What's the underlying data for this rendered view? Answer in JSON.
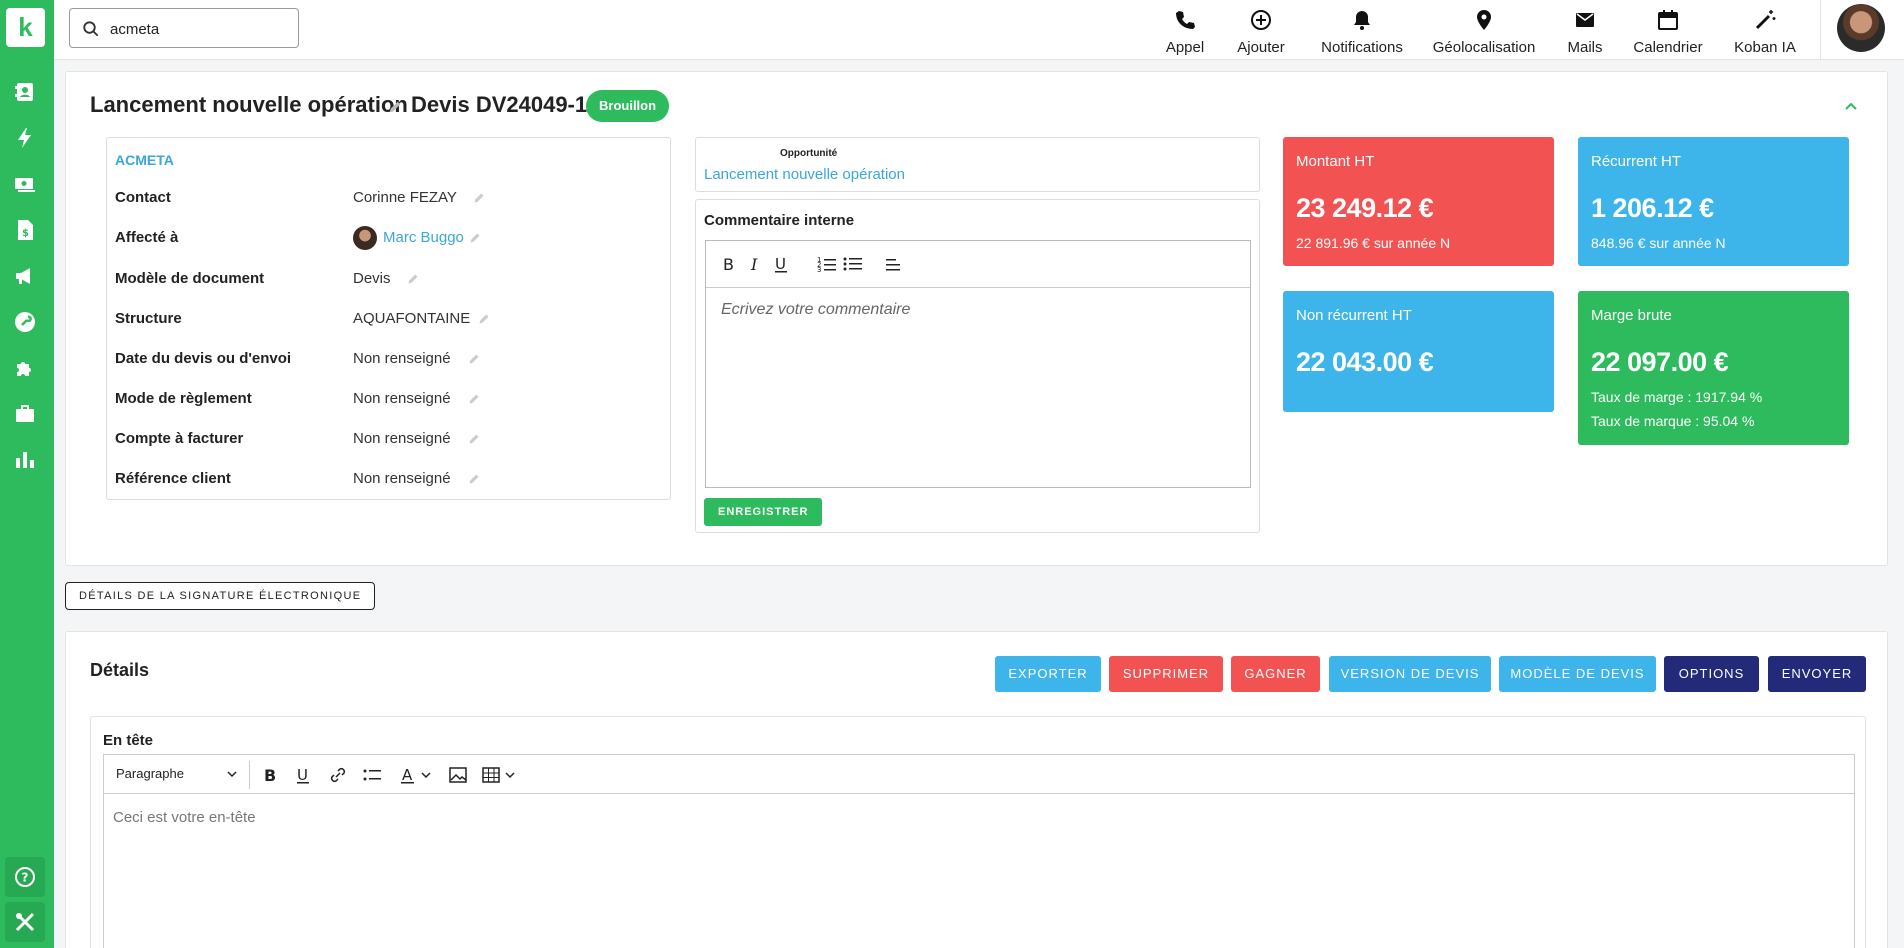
{
  "sidebar": {
    "logo": "k",
    "items": [
      "contacts-icon",
      "bolt-icon",
      "money-icon",
      "invoice-icon",
      "megaphone-icon",
      "wrench-icon",
      "puzzle-icon",
      "briefcase-icon",
      "chart-icon"
    ],
    "bottom": [
      "help-icon",
      "tools-icon"
    ],
    "color": "#2dbb5e"
  },
  "search": {
    "value": "acmeta"
  },
  "topnav": [
    {
      "icon": "phone-icon",
      "label": "Appel"
    },
    {
      "icon": "add-circle-icon",
      "label": "Ajouter"
    },
    {
      "icon": "bell-icon",
      "label": "Notifications"
    },
    {
      "icon": "location-pin-icon",
      "label": "Géolocalisation"
    },
    {
      "icon": "mail-icon",
      "label": "Mails"
    },
    {
      "icon": "calendar-icon",
      "label": "Calendrier"
    },
    {
      "icon": "magic-wand-icon",
      "label": "Koban IA"
    }
  ],
  "header": {
    "title": "Lancement nouvelle opération",
    "devis_number": "Devis DV24049-1",
    "status": "Brouillon"
  },
  "info": {
    "company": "ACMETA",
    "rows": [
      {
        "label": "Contact",
        "value": "Corinne FEZAY"
      },
      {
        "label": "Affecté à",
        "value": "Marc Buggo"
      },
      {
        "label": "Modèle de document",
        "value": "Devis"
      },
      {
        "label": "Structure",
        "value": "AQUAFONTAINE"
      },
      {
        "label": "Date du devis ou d'envoi",
        "value": "Non renseigné"
      },
      {
        "label": "Mode de règlement",
        "value": "Non renseigné"
      },
      {
        "label": "Compte à facturer",
        "value": "Non renseigné"
      },
      {
        "label": "Référence client",
        "value": "Non renseigné"
      }
    ]
  },
  "opportunity": {
    "label": "Opportunité",
    "value": "Lancement nouvelle opération"
  },
  "comment": {
    "title": "Commentaire interne",
    "placeholder": "Ecrivez votre commentaire",
    "save_label": "ENREGISTRER"
  },
  "kpis": {
    "montant": {
      "title": "Montant HT",
      "value": "23 249.12 €",
      "sub": "22 891.96 € sur année N",
      "color": "#f25252"
    },
    "recurrent": {
      "title": "Récurrent HT",
      "value": "1 206.12 €",
      "sub": "848.96 € sur année N",
      "color": "#3db4ea"
    },
    "non_recurrent": {
      "title": "Non récurrent HT",
      "value": "22 043.00 €",
      "color": "#3db4ea"
    },
    "marge": {
      "title": "Marge brute",
      "value": "22 097.00 €",
      "sub1": "Taux de marge : 1917.94 %",
      "sub2": "Taux de marque : 95.04 %",
      "color": "#2dbb5e"
    }
  },
  "signature_button": "DÉTAILS DE LA SIGNATURE ÉLECTRONIQUE",
  "details": {
    "title": "Détails",
    "actions": [
      {
        "label": "EXPORTER",
        "color": "#3db4ea"
      },
      {
        "label": "SUPPRIMER",
        "color": "#f25252"
      },
      {
        "label": "GAGNER",
        "color": "#f25252"
      },
      {
        "label": "VERSION DE DEVIS",
        "color": "#3db4ea"
      },
      {
        "label": "MODÈLE DE DEVIS",
        "color": "#3db4ea"
      },
      {
        "label": "OPTIONS",
        "color": "#232a7a"
      },
      {
        "label": "ENVOYER",
        "color": "#232a7a"
      }
    ],
    "entete": {
      "title": "En tête",
      "paragraph_select": "Paragraphe",
      "placeholder": "Ceci est votre en-tête"
    }
  }
}
